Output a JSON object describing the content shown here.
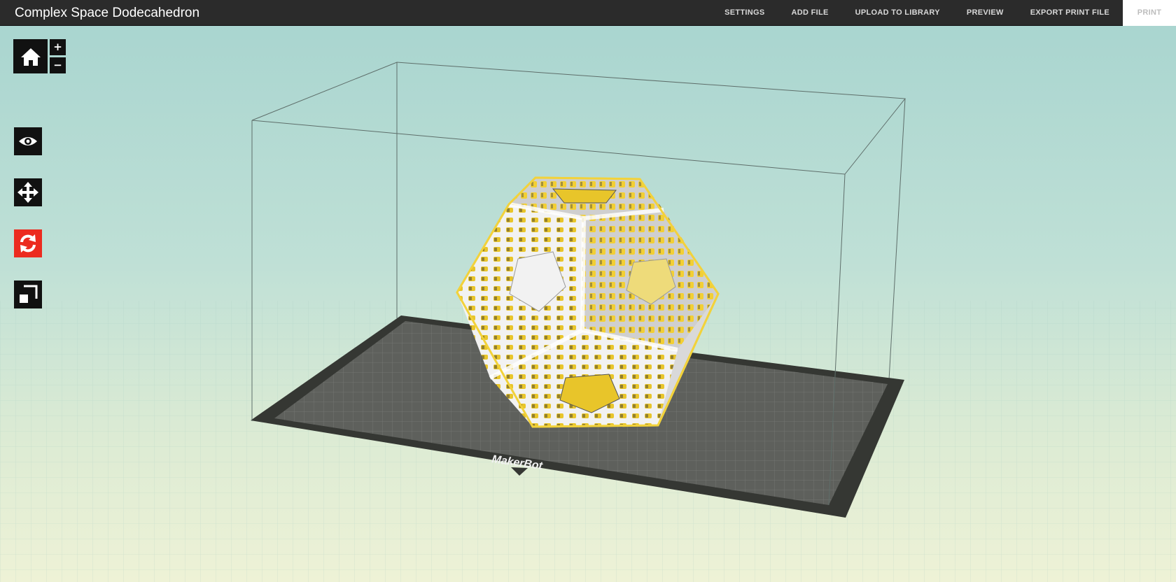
{
  "app": {
    "title": "Complex Space Dodecahedron"
  },
  "nav": {
    "settings": "SETTINGS",
    "add_file": "ADD FILE",
    "upload": "UPLOAD TO LIBRARY",
    "preview": "PREVIEW",
    "export": "EXPORT PRINT FILE",
    "print": "PRINT"
  },
  "view_controls": {
    "zoom_in": "+",
    "zoom_out": "−"
  },
  "tools": [
    {
      "name": "view",
      "icon": "eye-icon",
      "active": false
    },
    {
      "name": "move",
      "icon": "move-icon",
      "active": false
    },
    {
      "name": "rotate",
      "icon": "rotate-icon",
      "active": true
    },
    {
      "name": "scale",
      "icon": "scale-icon",
      "active": false
    }
  ],
  "build_plate": {
    "brand": "MakerBot"
  },
  "colors": {
    "topbar": "#2b2b2b",
    "active_tool": "#ec2b1f",
    "selection_outline": "#f2d23b",
    "plate": "#5b5d5a"
  }
}
